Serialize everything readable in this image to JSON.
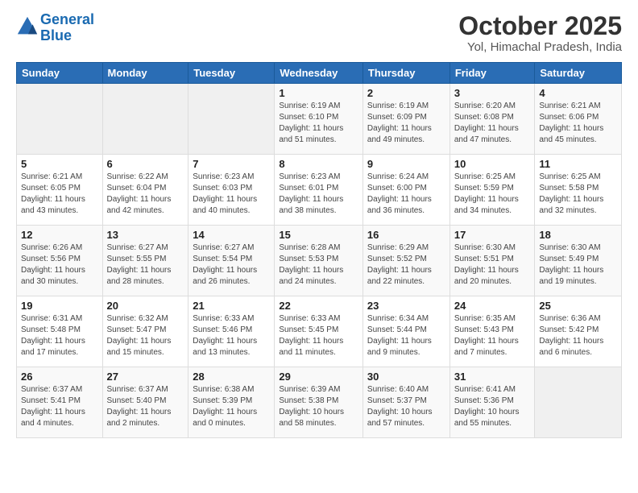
{
  "header": {
    "logo_line1": "General",
    "logo_line2": "Blue",
    "month_title": "October 2025",
    "location": "Yol, Himachal Pradesh, India"
  },
  "weekdays": [
    "Sunday",
    "Monday",
    "Tuesday",
    "Wednesday",
    "Thursday",
    "Friday",
    "Saturday"
  ],
  "weeks": [
    [
      {
        "day": "",
        "info": ""
      },
      {
        "day": "",
        "info": ""
      },
      {
        "day": "",
        "info": ""
      },
      {
        "day": "1",
        "info": "Sunrise: 6:19 AM\nSunset: 6:10 PM\nDaylight: 11 hours\nand 51 minutes."
      },
      {
        "day": "2",
        "info": "Sunrise: 6:19 AM\nSunset: 6:09 PM\nDaylight: 11 hours\nand 49 minutes."
      },
      {
        "day": "3",
        "info": "Sunrise: 6:20 AM\nSunset: 6:08 PM\nDaylight: 11 hours\nand 47 minutes."
      },
      {
        "day": "4",
        "info": "Sunrise: 6:21 AM\nSunset: 6:06 PM\nDaylight: 11 hours\nand 45 minutes."
      }
    ],
    [
      {
        "day": "5",
        "info": "Sunrise: 6:21 AM\nSunset: 6:05 PM\nDaylight: 11 hours\nand 43 minutes."
      },
      {
        "day": "6",
        "info": "Sunrise: 6:22 AM\nSunset: 6:04 PM\nDaylight: 11 hours\nand 42 minutes."
      },
      {
        "day": "7",
        "info": "Sunrise: 6:23 AM\nSunset: 6:03 PM\nDaylight: 11 hours\nand 40 minutes."
      },
      {
        "day": "8",
        "info": "Sunrise: 6:23 AM\nSunset: 6:01 PM\nDaylight: 11 hours\nand 38 minutes."
      },
      {
        "day": "9",
        "info": "Sunrise: 6:24 AM\nSunset: 6:00 PM\nDaylight: 11 hours\nand 36 minutes."
      },
      {
        "day": "10",
        "info": "Sunrise: 6:25 AM\nSunset: 5:59 PM\nDaylight: 11 hours\nand 34 minutes."
      },
      {
        "day": "11",
        "info": "Sunrise: 6:25 AM\nSunset: 5:58 PM\nDaylight: 11 hours\nand 32 minutes."
      }
    ],
    [
      {
        "day": "12",
        "info": "Sunrise: 6:26 AM\nSunset: 5:56 PM\nDaylight: 11 hours\nand 30 minutes."
      },
      {
        "day": "13",
        "info": "Sunrise: 6:27 AM\nSunset: 5:55 PM\nDaylight: 11 hours\nand 28 minutes."
      },
      {
        "day": "14",
        "info": "Sunrise: 6:27 AM\nSunset: 5:54 PM\nDaylight: 11 hours\nand 26 minutes."
      },
      {
        "day": "15",
        "info": "Sunrise: 6:28 AM\nSunset: 5:53 PM\nDaylight: 11 hours\nand 24 minutes."
      },
      {
        "day": "16",
        "info": "Sunrise: 6:29 AM\nSunset: 5:52 PM\nDaylight: 11 hours\nand 22 minutes."
      },
      {
        "day": "17",
        "info": "Sunrise: 6:30 AM\nSunset: 5:51 PM\nDaylight: 11 hours\nand 20 minutes."
      },
      {
        "day": "18",
        "info": "Sunrise: 6:30 AM\nSunset: 5:49 PM\nDaylight: 11 hours\nand 19 minutes."
      }
    ],
    [
      {
        "day": "19",
        "info": "Sunrise: 6:31 AM\nSunset: 5:48 PM\nDaylight: 11 hours\nand 17 minutes."
      },
      {
        "day": "20",
        "info": "Sunrise: 6:32 AM\nSunset: 5:47 PM\nDaylight: 11 hours\nand 15 minutes."
      },
      {
        "day": "21",
        "info": "Sunrise: 6:33 AM\nSunset: 5:46 PM\nDaylight: 11 hours\nand 13 minutes."
      },
      {
        "day": "22",
        "info": "Sunrise: 6:33 AM\nSunset: 5:45 PM\nDaylight: 11 hours\nand 11 minutes."
      },
      {
        "day": "23",
        "info": "Sunrise: 6:34 AM\nSunset: 5:44 PM\nDaylight: 11 hours\nand 9 minutes."
      },
      {
        "day": "24",
        "info": "Sunrise: 6:35 AM\nSunset: 5:43 PM\nDaylight: 11 hours\nand 7 minutes."
      },
      {
        "day": "25",
        "info": "Sunrise: 6:36 AM\nSunset: 5:42 PM\nDaylight: 11 hours\nand 6 minutes."
      }
    ],
    [
      {
        "day": "26",
        "info": "Sunrise: 6:37 AM\nSunset: 5:41 PM\nDaylight: 11 hours\nand 4 minutes."
      },
      {
        "day": "27",
        "info": "Sunrise: 6:37 AM\nSunset: 5:40 PM\nDaylight: 11 hours\nand 2 minutes."
      },
      {
        "day": "28",
        "info": "Sunrise: 6:38 AM\nSunset: 5:39 PM\nDaylight: 11 hours\nand 0 minutes."
      },
      {
        "day": "29",
        "info": "Sunrise: 6:39 AM\nSunset: 5:38 PM\nDaylight: 10 hours\nand 58 minutes."
      },
      {
        "day": "30",
        "info": "Sunrise: 6:40 AM\nSunset: 5:37 PM\nDaylight: 10 hours\nand 57 minutes."
      },
      {
        "day": "31",
        "info": "Sunrise: 6:41 AM\nSunset: 5:36 PM\nDaylight: 10 hours\nand 55 minutes."
      },
      {
        "day": "",
        "info": ""
      }
    ]
  ]
}
